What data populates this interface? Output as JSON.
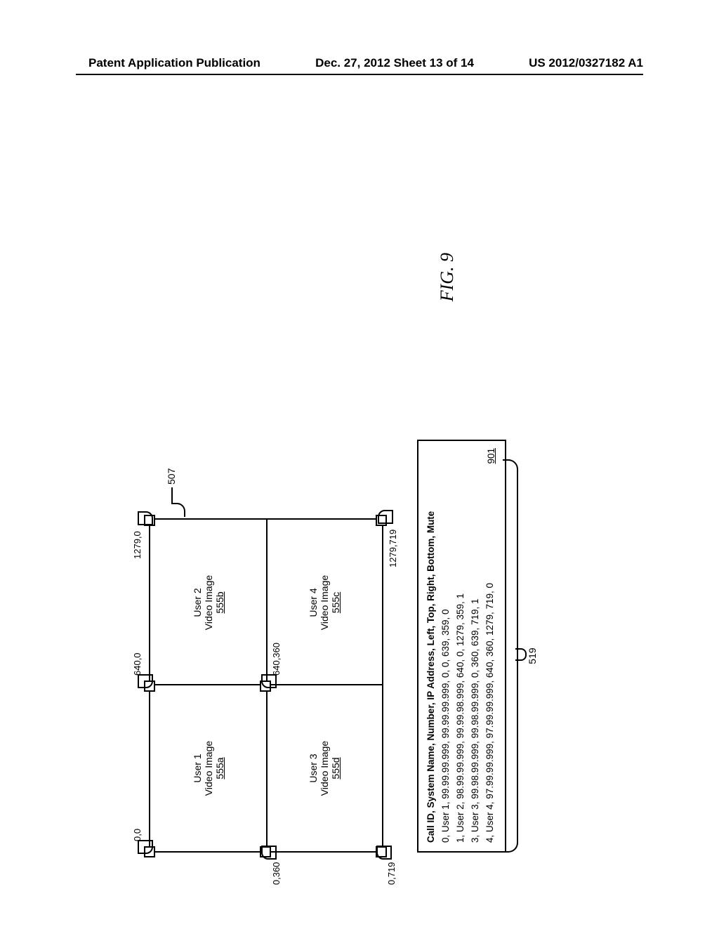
{
  "header": {
    "left": "Patent Application Publication",
    "center": "Dec. 27, 2012  Sheet 13 of 14",
    "right": "US 2012/0327182 A1"
  },
  "figure": {
    "label": "FIG. 9",
    "frame_ref": "507",
    "brace_ref": "519",
    "coords": {
      "tl": "0,0",
      "tm": "640,0",
      "tr": "1279,0",
      "ml": "0,360",
      "mm": "640,360",
      "bl": "0,719",
      "br": "1279,719"
    },
    "cells": {
      "tl": {
        "l1": "User 1",
        "l2": "Video Image",
        "l3": "555a"
      },
      "tr": {
        "l1": "User 2",
        "l2": "Video Image",
        "l3": "555b"
      },
      "bl": {
        "l1": "User 3",
        "l2": "Video Image",
        "l3": "555d"
      },
      "br": {
        "l1": "User 4",
        "l2": "Video Image",
        "l3": "555c"
      }
    },
    "table": {
      "ref": "901",
      "header": "Call ID, System Name, Number, IP Address, Left, Top, Right, Bottom, Mute",
      "rows": [
        "0, User 1, 99.99.99.999, 99.99.99.999, 0, 0, 639, 359, 0",
        "1, User 2, 98.99.99.999, 99.99.98.999, 640, 0, 1279, 359, 1",
        "3, User 3, 99.98.99.999, 99.98.99.999, 0, 360, 639, 719, 1",
        "4, User 4, 97.99.99.999, 97.99.99.999, 640, 360, 1279, 719, 0"
      ]
    }
  }
}
